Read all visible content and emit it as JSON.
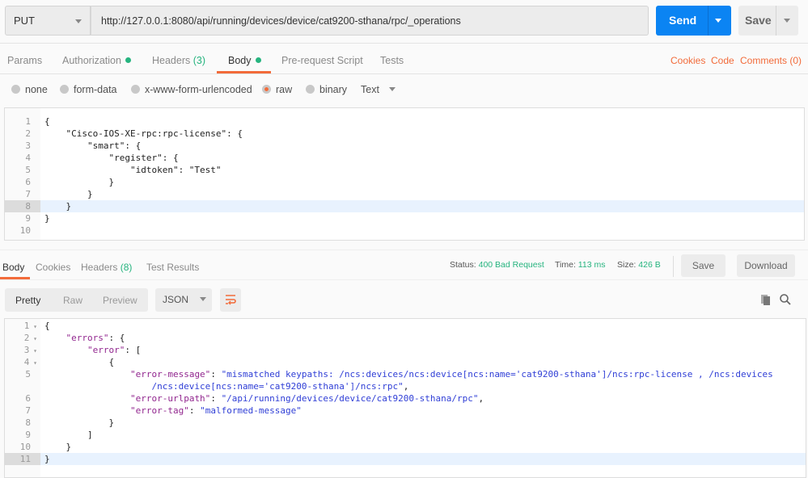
{
  "request": {
    "method": "PUT",
    "url": "http://127.0.0.1:8080/api/running/devices/device/cat9200-sthana/rpc/_operations",
    "send_label": "Send",
    "save_label": "Save"
  },
  "req_tabs": {
    "params": "Params",
    "authorization": "Authorization",
    "headers": "Headers",
    "headers_count": "(3)",
    "body": "Body",
    "prerequest": "Pre-request Script",
    "tests": "Tests",
    "cookies": "Cookies",
    "code": "Code",
    "comments": "Comments (0)"
  },
  "body_types": {
    "none": "none",
    "form_data": "form-data",
    "urlencoded": "x-www-form-urlencoded",
    "raw": "raw",
    "binary": "binary",
    "selected": "raw",
    "format": "Text"
  },
  "request_body": {
    "active_line": 8,
    "lines": [
      "{",
      "    \"Cisco-IOS-XE-rpc:rpc-license\": {",
      "        \"smart\": {",
      "            \"register\": {",
      "                \"idtoken\": \"Test\"",
      "            }",
      "        }",
      "    }",
      "}",
      ""
    ]
  },
  "response": {
    "tabs": {
      "body": "Body",
      "cookies": "Cookies",
      "headers": "Headers",
      "headers_count": "(8)",
      "tests": "Test Results"
    },
    "status_label": "Status:",
    "status": "400 Bad Request",
    "time_label": "Time:",
    "time": "113 ms",
    "size_label": "Size:",
    "size": "426 B",
    "save_label": "Save",
    "download_label": "Download",
    "views": {
      "pretty": "Pretty",
      "raw": "Raw",
      "preview": "Preview",
      "format": "JSON"
    },
    "active_line": 11,
    "lines": [
      {
        "n": "1",
        "fold": true,
        "t": [
          [
            "p",
            "{"
          ]
        ]
      },
      {
        "n": "2",
        "fold": true,
        "t": [
          [
            "p",
            "    "
          ],
          [
            "k",
            "\"errors\""
          ],
          [
            "p",
            ": {"
          ]
        ]
      },
      {
        "n": "3",
        "fold": true,
        "t": [
          [
            "p",
            "        "
          ],
          [
            "k",
            "\"error\""
          ],
          [
            "p",
            ": ["
          ]
        ]
      },
      {
        "n": "4",
        "fold": true,
        "t": [
          [
            "p",
            "            {"
          ]
        ]
      },
      {
        "n": "5",
        "t": [
          [
            "p",
            "                "
          ],
          [
            "k",
            "\"error-message\""
          ],
          [
            "p",
            ": "
          ],
          [
            "s",
            "\"mismatched keypaths: /ncs:devices/ncs:device[ncs:name='cat9200-sthana']/ncs:rpc-license , /ncs:devices"
          ]
        ]
      },
      {
        "n": "",
        "t": [
          [
            "s",
            "                    /ncs:device[ncs:name='cat9200-sthana']/ncs:rpc\""
          ],
          [
            "p",
            ","
          ]
        ]
      },
      {
        "n": "6",
        "t": [
          [
            "p",
            "                "
          ],
          [
            "k",
            "\"error-urlpath\""
          ],
          [
            "p",
            ": "
          ],
          [
            "s",
            "\"/api/running/devices/device/cat9200-sthana/rpc\""
          ],
          [
            "p",
            ","
          ]
        ]
      },
      {
        "n": "7",
        "t": [
          [
            "p",
            "                "
          ],
          [
            "k",
            "\"error-tag\""
          ],
          [
            "p",
            ": "
          ],
          [
            "s",
            "\"malformed-message\""
          ]
        ]
      },
      {
        "n": "8",
        "t": [
          [
            "p",
            "            }"
          ]
        ]
      },
      {
        "n": "9",
        "t": [
          [
            "p",
            "        ]"
          ]
        ]
      },
      {
        "n": "10",
        "t": [
          [
            "p",
            "    }"
          ]
        ]
      },
      {
        "n": "11",
        "t": [
          [
            "p",
            "}"
          ]
        ]
      }
    ]
  },
  "colors": {
    "accent": "#f26b3a",
    "send": "#0b84f3",
    "status_green": "#26b47f",
    "json_key": "#92278f",
    "json_string": "#2f3ed6"
  },
  "icons": {
    "copy": "copy-icon",
    "search": "search-icon",
    "wrap": "wrap-lines-icon"
  }
}
